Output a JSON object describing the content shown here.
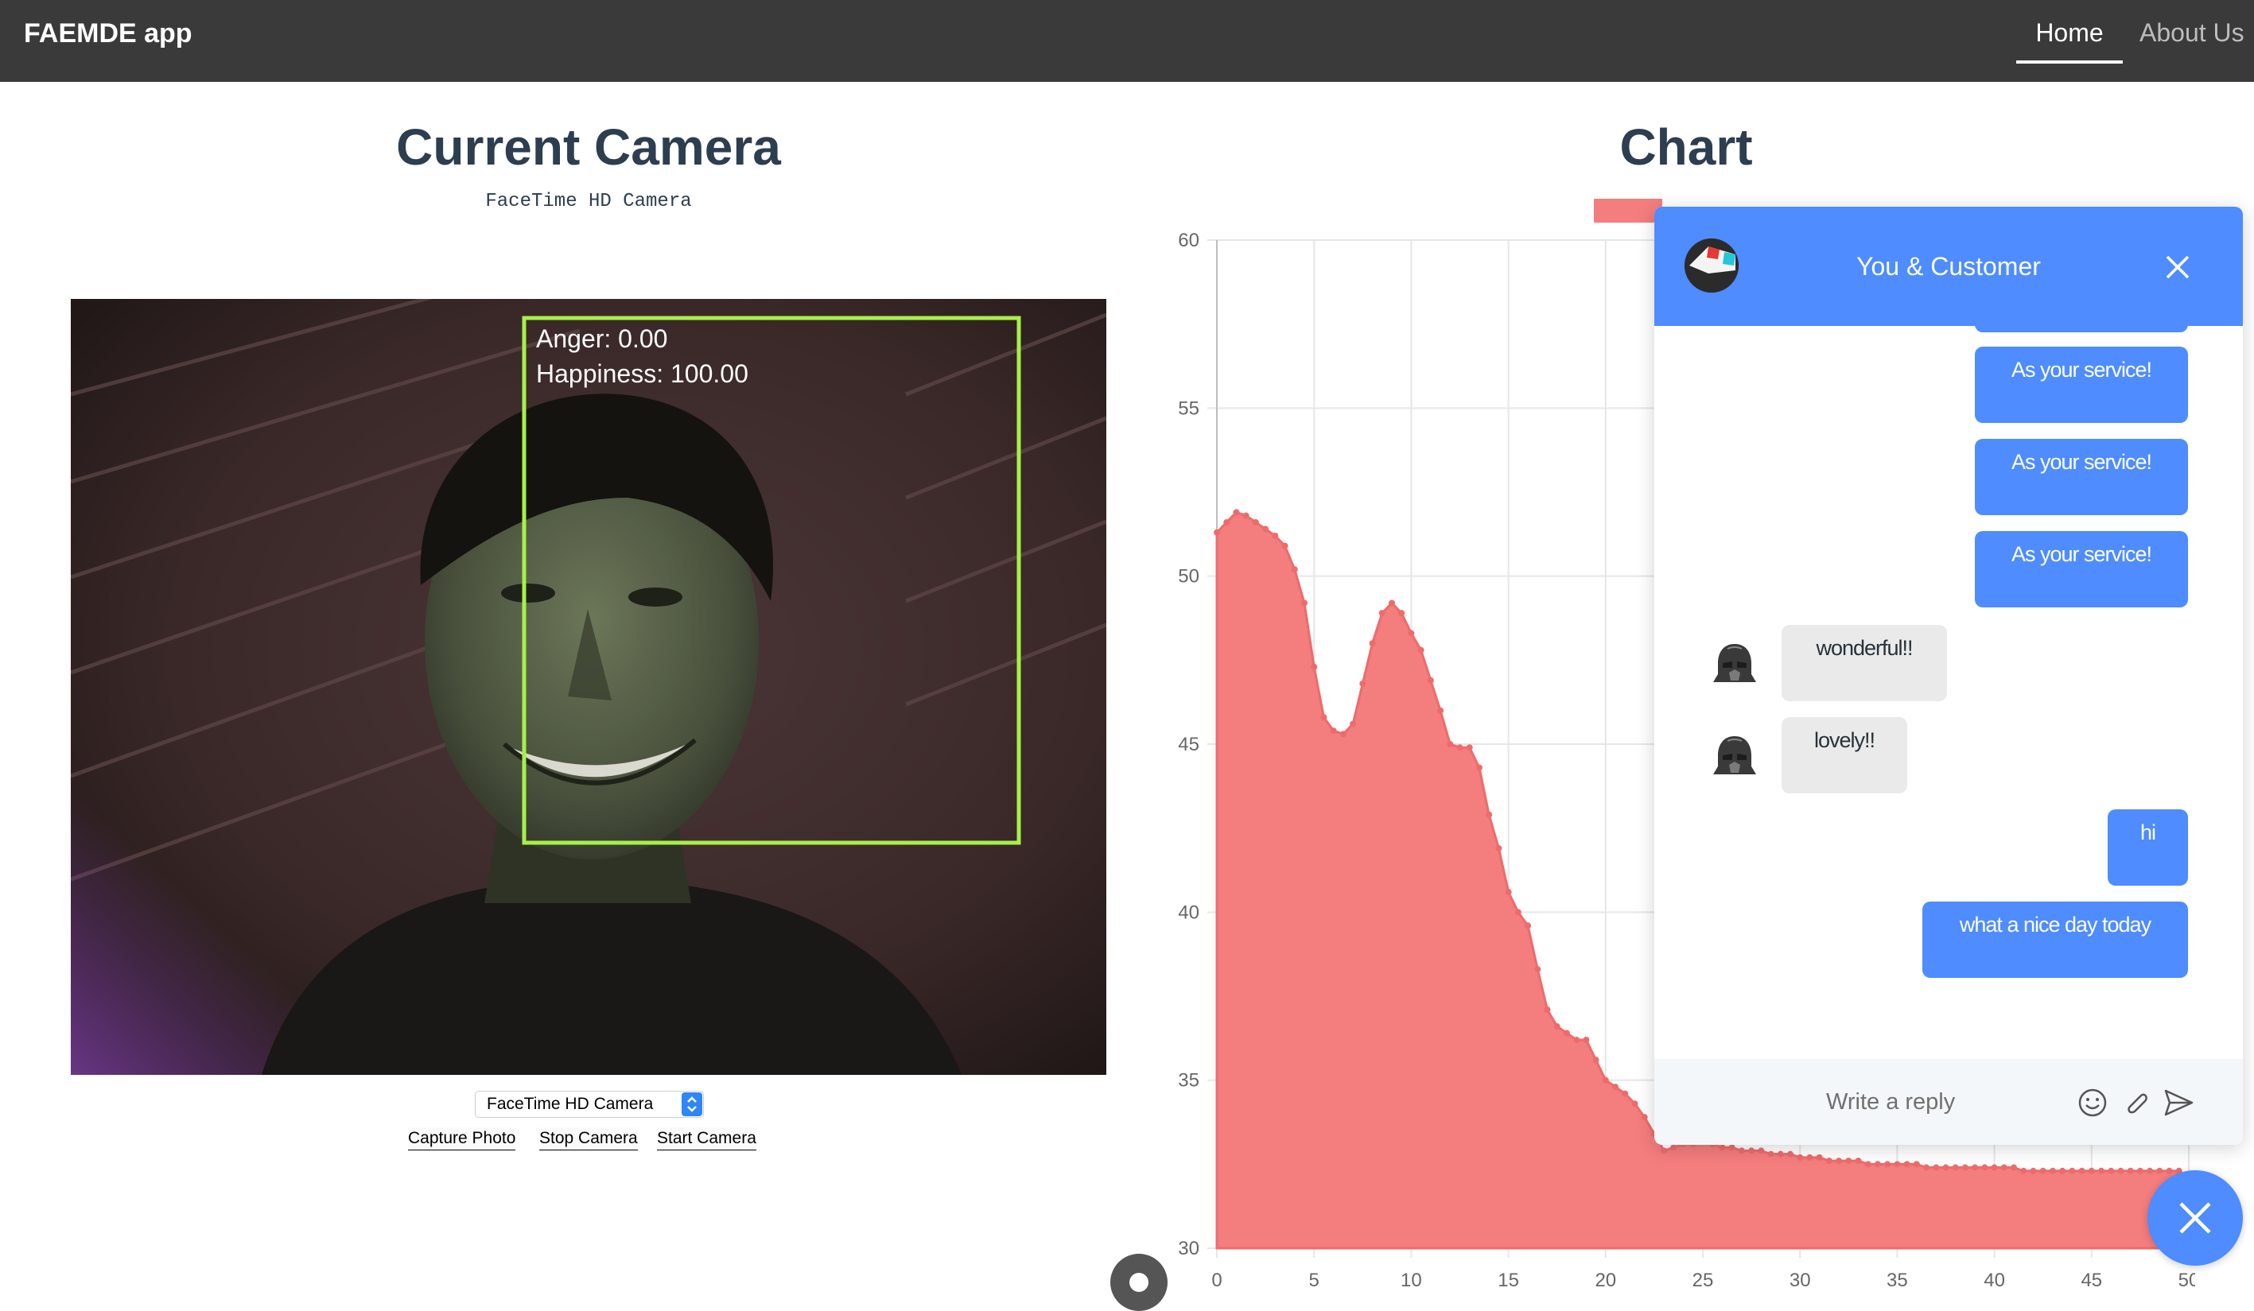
{
  "navbar": {
    "brand": "FAEMDE app",
    "links": [
      "Home",
      "About Us"
    ],
    "active": "Home"
  },
  "camera": {
    "title": "Current Camera",
    "device_name": "FaceTime HD Camera",
    "overlay_lines": [
      "Anger: 0.00",
      "Happiness: 100.00"
    ],
    "select_value": "FaceTime HD Camera",
    "buttons": [
      "Capture Photo",
      "Stop Camera",
      "Start Camera"
    ]
  },
  "chart": {
    "title": "Chart",
    "legend_color": "#f47d7d"
  },
  "chart_data": {
    "type": "area",
    "title": "Chart",
    "xlabel": "",
    "ylabel": "",
    "xlim": [
      0,
      50
    ],
    "ylim": [
      30,
      60
    ],
    "xticks": [
      0,
      5,
      10,
      15,
      20,
      25,
      30,
      35,
      40,
      45,
      50
    ],
    "yticks": [
      30,
      35,
      40,
      45,
      50,
      55,
      60
    ],
    "grid": true,
    "color": "#f47d7d",
    "x": [
      0,
      0.5,
      1,
      1.5,
      2,
      2.5,
      3,
      3.5,
      4,
      4.5,
      5,
      5.5,
      6,
      6.5,
      7,
      7.5,
      8,
      8.5,
      9,
      9.5,
      10,
      10.5,
      11,
      11.5,
      12,
      12.5,
      13,
      13.5,
      14,
      14.5,
      15,
      15.5,
      16,
      16.5,
      17,
      17.5,
      18,
      18.5,
      19,
      19.5,
      20,
      20.5,
      21,
      21.5,
      22,
      22.5,
      23,
      23.5,
      24,
      24.5,
      25,
      25.5,
      26,
      26.5,
      27,
      27.5,
      28,
      28.5,
      29,
      29.5,
      30,
      30.5,
      31,
      31.5,
      32,
      32.5,
      33,
      33.5,
      34,
      34.5,
      35,
      35.5,
      36,
      36.5,
      37,
      37.5,
      38,
      38.5,
      39,
      39.5,
      40,
      40.5,
      41,
      41.5,
      42,
      42.5,
      43,
      43.5,
      44,
      44.5,
      45,
      45.5,
      46,
      46.5,
      47,
      47.5,
      48,
      48.5,
      49,
      49.5
    ],
    "y": [
      51.3,
      51.6,
      51.9,
      51.8,
      51.6,
      51.4,
      51.2,
      50.9,
      50.2,
      49.2,
      47.3,
      45.8,
      45.4,
      45.3,
      45.6,
      46.8,
      48.0,
      48.9,
      49.2,
      48.9,
      48.3,
      47.8,
      46.9,
      46.0,
      45.0,
      44.9,
      44.9,
      44.3,
      42.9,
      41.9,
      40.6,
      40.0,
      39.6,
      38.3,
      37.1,
      36.6,
      36.4,
      36.2,
      36.2,
      35.6,
      35.0,
      34.8,
      34.6,
      34.3,
      33.9,
      33.4,
      32.9,
      33.0,
      33.1,
      33.1,
      33.2,
      33.1,
      33.0,
      33.0,
      32.9,
      32.9,
      32.9,
      32.8,
      32.8,
      32.8,
      32.7,
      32.7,
      32.7,
      32.6,
      32.6,
      32.6,
      32.6,
      32.5,
      32.5,
      32.5,
      32.5,
      32.5,
      32.5,
      32.4,
      32.4,
      32.4,
      32.4,
      32.4,
      32.4,
      32.4,
      32.4,
      32.4,
      32.4,
      32.3,
      32.3,
      32.3,
      32.3,
      32.3,
      32.3,
      32.3,
      32.3,
      32.3,
      32.3,
      32.3,
      32.3,
      32.3,
      32.3,
      32.3,
      32.3,
      32.3
    ]
  },
  "chat": {
    "title": "You & Customer",
    "messages": [
      {
        "from": "me",
        "text": "As your service!"
      },
      {
        "from": "me",
        "text": "As your service!"
      },
      {
        "from": "me",
        "text": "As your service!"
      },
      {
        "from": "them",
        "text": "wonderful!!"
      },
      {
        "from": "them",
        "text": "lovely!!"
      },
      {
        "from": "me",
        "text": "hi"
      },
      {
        "from": "me",
        "text": "what a nice day today"
      }
    ],
    "input_placeholder": "Write a reply",
    "accent": "#4e8cff"
  }
}
